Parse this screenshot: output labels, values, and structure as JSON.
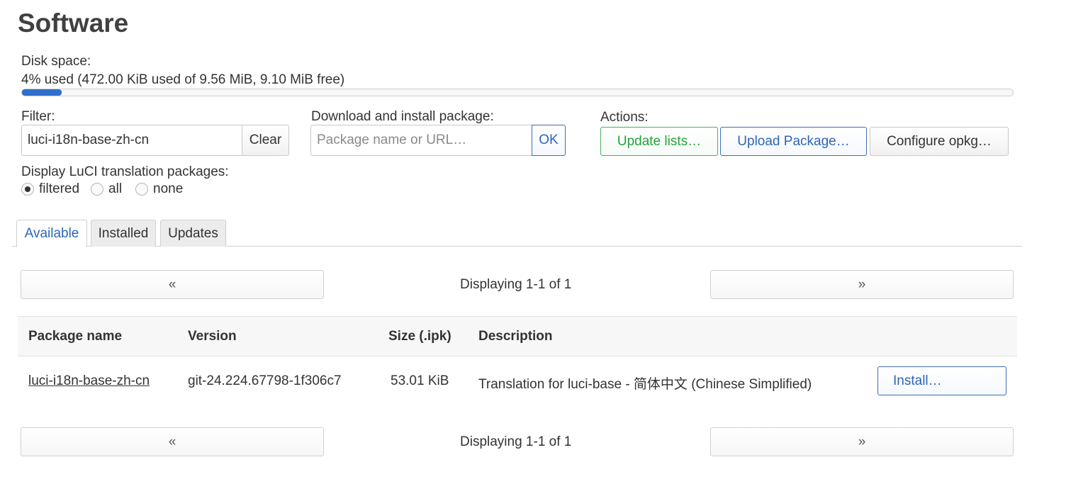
{
  "page": {
    "title": "Software"
  },
  "disk": {
    "label": "Disk space:",
    "usage_text": "4% used (472.00 KiB used of 9.56 MiB, 9.10 MiB free)",
    "used_fraction": 0.04,
    "bar_color": "#2f6fce"
  },
  "filter": {
    "label": "Filter:",
    "value": "luci-i18n-base-zh-cn",
    "clear_label": "Clear"
  },
  "download": {
    "label": "Download and install package:",
    "placeholder": "Package name or URL…",
    "ok_label": "OK"
  },
  "actions": {
    "label": "Actions:",
    "update_lists": "Update lists…",
    "upload_package": "Upload Package…",
    "configure_opkg": "Configure opkg…"
  },
  "translation": {
    "label": "Display LuCI translation packages:",
    "options": [
      "filtered",
      "all",
      "none"
    ],
    "selected": "filtered"
  },
  "tabs": [
    {
      "label": "Available",
      "active": true
    },
    {
      "label": "Installed",
      "active": false
    },
    {
      "label": "Updates",
      "active": false
    }
  ],
  "pager": {
    "prev": "«",
    "next": "»",
    "status": "Displaying 1-1 of 1"
  },
  "table": {
    "headers": [
      "Package name",
      "Version",
      "Size (.ipk)",
      "Description"
    ],
    "rows": [
      {
        "name": "luci-i18n-base-zh-cn",
        "version": "git-24.224.67798-1f306c7",
        "size": "53.01 KiB",
        "description": "Translation for luci-base - 简体中文 (Chinese Simplified)",
        "action": "Install…"
      }
    ]
  }
}
